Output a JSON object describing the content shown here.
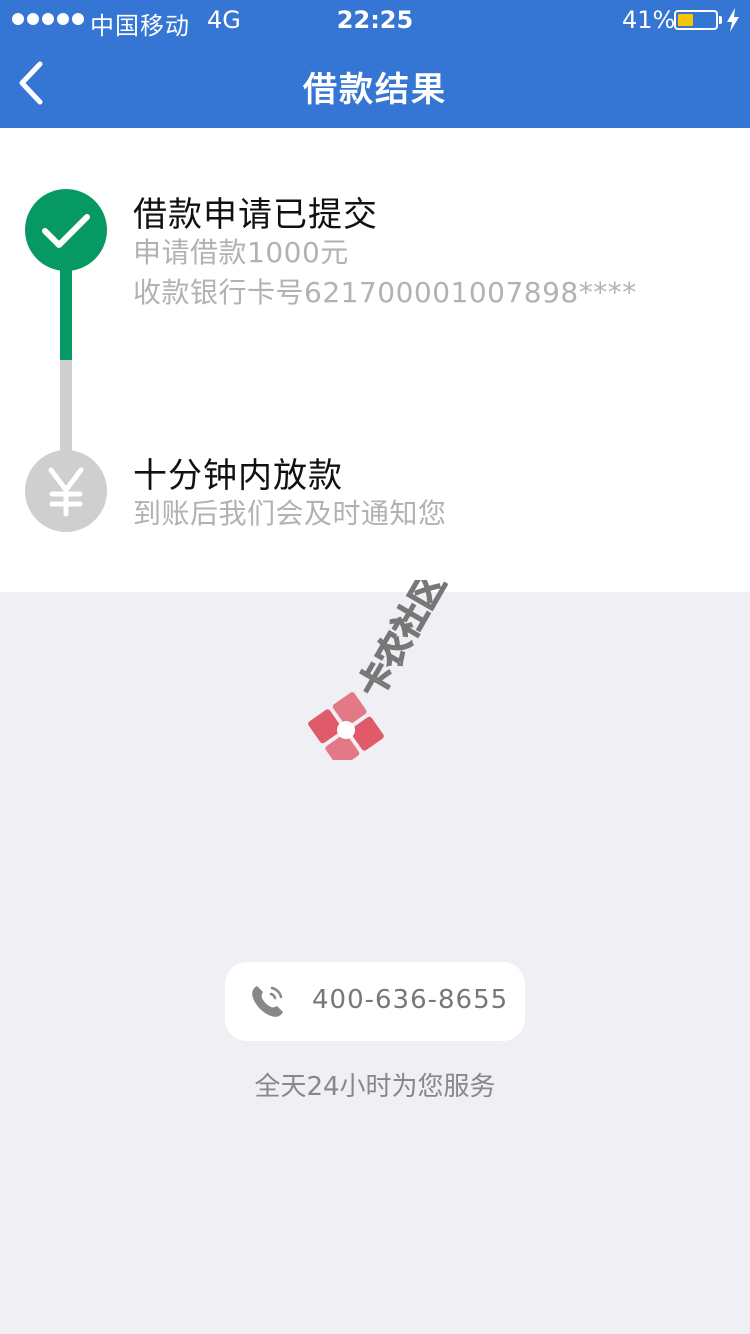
{
  "status_bar": {
    "carrier": "中国移动",
    "network": "4G",
    "time": "22:25",
    "battery_percent_label": "41%",
    "battery_level": 0.41,
    "signal_dots": 5
  },
  "nav": {
    "title": "借款结果",
    "back_icon": "chevron-left-icon"
  },
  "steps": [
    {
      "title": "借款申请已提交",
      "lines": [
        "申请借款1000元",
        "收款银行卡号621700001007898****"
      ],
      "icon": "check-icon",
      "status": "done",
      "color": "#069964"
    },
    {
      "title": "十分钟内放款",
      "lines": [
        "到账后我们会及时通知您"
      ],
      "icon": "yen-icon",
      "status": "pending",
      "color": "#cfcfcf"
    }
  ],
  "support": {
    "phone": "400-636-8655",
    "phone_icon": "phone-icon",
    "hours": "全天24小时为您服务"
  },
  "watermark": {
    "text": "卡农社区",
    "logo_icon": "kanong-logo-icon"
  },
  "colors": {
    "primary_blue": "#3575d3",
    "success_green": "#069964",
    "pending_grey": "#cfcfcf",
    "battery_yellow": "#f7c600",
    "page_background": "#efeff4"
  }
}
